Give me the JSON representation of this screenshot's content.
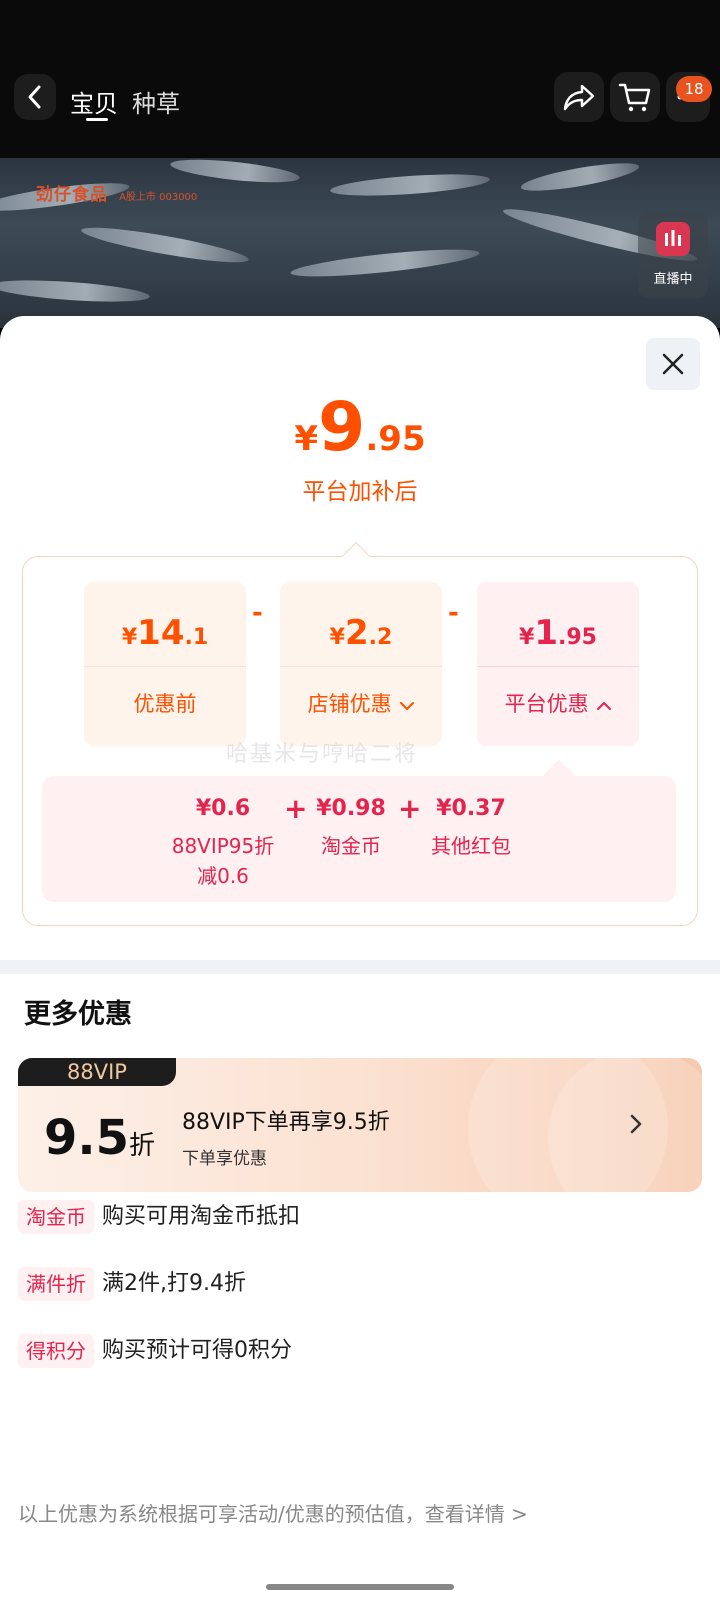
{
  "header": {
    "tabs": [
      {
        "label": "宝贝",
        "active": true
      },
      {
        "label": "种草",
        "active": false
      }
    ],
    "cart_badge": "18",
    "icons": [
      "back-arrow-icon",
      "share-icon",
      "cart-icon",
      "more-icon"
    ]
  },
  "media": {
    "brand": "劲仔食品",
    "brand_stock": "A股上市 003000",
    "live_label": "直播中"
  },
  "sheet": {
    "final_price": {
      "currency": "¥",
      "integer": "9",
      "decimal": ".95"
    },
    "caption": "平台加补后",
    "breakdown": [
      {
        "currency": "¥",
        "integer": "14",
        "decimal": ".1",
        "label": "优惠前",
        "chevron": ""
      },
      {
        "currency": "¥",
        "integer": "2",
        "decimal": ".2",
        "label": "店铺优惠",
        "chevron": "down"
      },
      {
        "currency": "¥",
        "integer": "1",
        "decimal": ".95",
        "label": "平台优惠",
        "chevron": "up"
      }
    ],
    "operator_minus": "-",
    "platform_items": [
      {
        "value": "¥0.6",
        "name": "88VIP95折",
        "name2": "减0.6"
      },
      {
        "value": "¥0.98",
        "name": "淘金币"
      },
      {
        "value": "¥0.37",
        "name": "其他红包"
      }
    ],
    "operator_plus": "+",
    "watermark": "哈基米与哼哈二将"
  },
  "more_offers": {
    "title": "更多优惠",
    "vip": {
      "tag": "88VIP",
      "discount_num": "9.5",
      "discount_unit": "折",
      "title": "88VIP下单再享9.5折",
      "subtitle": "下单享优惠"
    },
    "benefits": [
      {
        "tag": "淘金币",
        "desc": "购买可用淘金币抵扣"
      },
      {
        "tag": "满件折",
        "desc": "满2件,打9.4折"
      },
      {
        "tag": "得积分",
        "desc": "购买预计可得0积分"
      }
    ],
    "footer": "以上优惠为系统根据可享活动/优惠的预估值，查看详情 >"
  },
  "colors": {
    "accent_orange": "#ff5000",
    "platform_red": "#e5244e",
    "badge": "#e8531f"
  }
}
